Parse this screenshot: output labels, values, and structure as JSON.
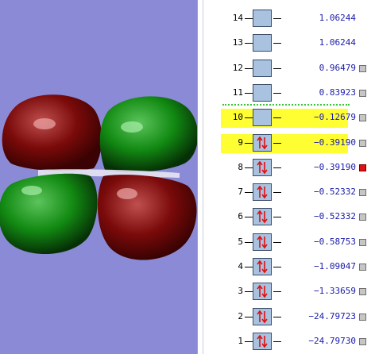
{
  "orbitals": [
    {
      "num": "14",
      "energy": "1.06244",
      "occupied": false,
      "highlighted": false,
      "checked": false
    },
    {
      "num": "13",
      "energy": "1.06244",
      "occupied": false,
      "highlighted": false,
      "checked": false
    },
    {
      "num": "12",
      "energy": "0.96479",
      "occupied": false,
      "highlighted": false,
      "checked": false
    },
    {
      "num": "11",
      "energy": "0.83923",
      "occupied": false,
      "highlighted": false,
      "checked": false
    },
    {
      "num": "10",
      "energy": "−0.12679",
      "occupied": false,
      "highlighted": true,
      "checked": false
    },
    {
      "num": "9",
      "energy": "−0.39190",
      "occupied": true,
      "highlighted": true,
      "checked": false
    },
    {
      "num": "8",
      "energy": "−0.39190",
      "occupied": true,
      "highlighted": false,
      "checked": true
    },
    {
      "num": "7",
      "energy": "−0.52332",
      "occupied": true,
      "highlighted": false,
      "checked": false
    },
    {
      "num": "6",
      "energy": "−0.52332",
      "occupied": true,
      "highlighted": false,
      "checked": false
    },
    {
      "num": "5",
      "energy": "−0.58753",
      "occupied": true,
      "highlighted": false,
      "checked": false
    },
    {
      "num": "4",
      "energy": "−1.09047",
      "occupied": true,
      "highlighted": false,
      "checked": false
    },
    {
      "num": "3",
      "energy": "−1.33659",
      "occupied": true,
      "highlighted": false,
      "checked": false
    },
    {
      "num": "2",
      "energy": "−24.79723",
      "occupied": true,
      "highlighted": false,
      "checked": false
    },
    {
      "num": "1",
      "energy": "−24.79730",
      "occupied": true,
      "highlighted": false,
      "checked": false
    }
  ],
  "colors": {
    "viewer_background": "#8a8ad6",
    "lobe_positive": "#8c0f0f",
    "lobe_negative": "#1b8a1b",
    "highlight": "#fffe32",
    "energy_text": "#1a1aa8",
    "electron_arrow": "#e01010",
    "orbital_box": "#a8c2e0",
    "homo_lumo_separator": "#32c832",
    "selected_checkbox": "#e01010"
  },
  "icons": {
    "electron_pair": "up-down-arrows-icon",
    "visibility": "checkbox-icon"
  }
}
